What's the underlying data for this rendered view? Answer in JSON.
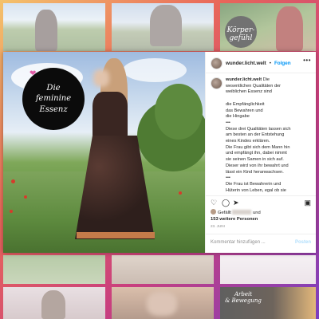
{
  "background_tiles": {
    "top_right_caption": "Körper-\ngefühl",
    "bottom_right_caption": "Arbeit\n& Bewegung"
  },
  "post": {
    "badge_text": "Die\nfeminine\nEssenz",
    "header": {
      "username": "wunder.licht.welt",
      "separator": "•",
      "follow_label": "Folgen",
      "more_icon": "•••"
    },
    "caption": {
      "username": "wunder.licht.welt",
      "lines": [
        "Die",
        "wesentlichen Qualitäten der",
        "weiblichen Essenz sind",
        "",
        "die Empfänglichkeit",
        "das Bewahren und",
        "die Hingabe",
        "•••",
        "Diese drei Qualitäten lassen sich",
        "am besten an der Entstehung",
        "eines Kindes erklären.",
        "Die Frau gibt sich dem Mann hin",
        "und empfängt ihn, dabei nimmt",
        "sie seinen Samen in sich auf.",
        "Dieser wird von ihr bewahrt und",
        "lässt ein Kind heranwachsen.",
        "•••",
        "Die Frau ist Bewahrerin und",
        "Hüterin von Leben, egal ob sie"
      ]
    },
    "likes": {
      "prefix": "Gefällt",
      "connector": "und",
      "count_text": "153 weitere Personen"
    },
    "date": "23. JUNI",
    "comment": {
      "placeholder": "Kommentar hinzufügen ...",
      "post_label": "Posten"
    }
  },
  "icons": {
    "like": "heart-outline",
    "comment": "speech-bubble",
    "share": "paper-plane",
    "save": "bookmark"
  },
  "colors": {
    "accent": "#0095f6",
    "badge": "#0b0b0b",
    "heart": "#e35aa6"
  }
}
